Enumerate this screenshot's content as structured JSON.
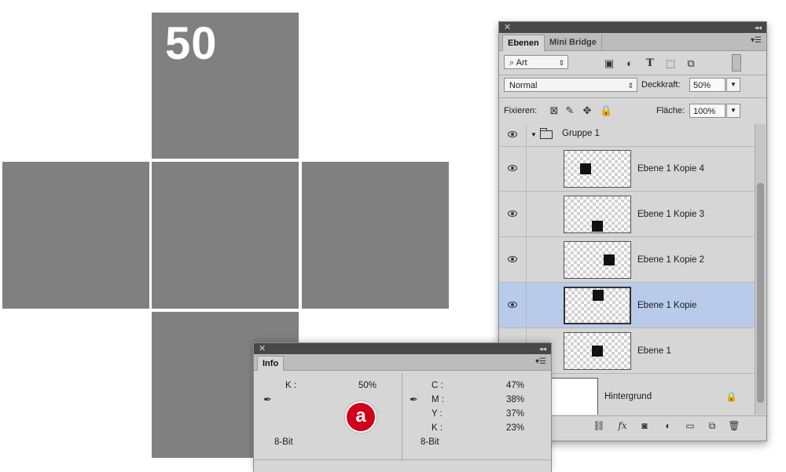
{
  "canvas": {
    "big_number": "50",
    "square_color": "#808080"
  },
  "layers_panel": {
    "tabs": [
      {
        "label": "Ebenen",
        "active": true
      },
      {
        "label": "Mini Bridge",
        "active": false
      }
    ],
    "filter": {
      "kind_label": "Art"
    },
    "blend_mode": "Normal",
    "opacity": {
      "label": "Deckkraft:",
      "value": "50%"
    },
    "lock": {
      "label": "Fixieren:"
    },
    "fill": {
      "label": "Fläche:",
      "value": "100%"
    },
    "group": {
      "name": "Gruppe 1"
    },
    "layers": [
      {
        "name": "Ebene 1 Kopie 4",
        "selected": false
      },
      {
        "name": "Ebene 1 Kopie 3",
        "selected": false
      },
      {
        "name": "Ebene 1 Kopie 2",
        "selected": false
      },
      {
        "name": "Ebene 1 Kopie",
        "selected": true
      },
      {
        "name": "Ebene 1",
        "selected": false
      },
      {
        "name": "Hintergrund",
        "selected": false,
        "locked": true
      }
    ],
    "selected_color": "#b9cbea"
  },
  "info_panel": {
    "tab": "Info",
    "left": {
      "k_label": "K :",
      "k_value": "50%",
      "bit": "8-Bit"
    },
    "right": {
      "c_label": "C :",
      "c_value": "47%",
      "m_label": "M :",
      "m_value": "38%",
      "y_label": "Y :",
      "y_value": "37%",
      "k_label": "K :",
      "k_value": "23%",
      "bit": "8-Bit"
    },
    "badge": {
      "label": "a",
      "color": "#d0021b"
    }
  }
}
